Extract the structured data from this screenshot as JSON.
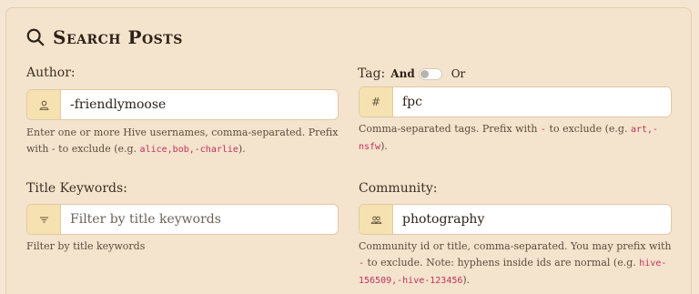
{
  "title": "Search Posts",
  "author": {
    "label": "Author:",
    "value": "-friendlymoose",
    "placeholder": "",
    "help_prefix": "Enter one or more Hive usernames, comma-separated. Prefix with - to exclude (e.g. ",
    "help_code": "alice,bob,-charlie",
    "help_suffix": ")."
  },
  "tag": {
    "label": "Tag:",
    "and_label": "And",
    "or_label": "Or",
    "addon": "#",
    "value": "fpc",
    "help_prefix": "Comma-separated tags. Prefix with ",
    "help_minus": "-",
    "help_middle": " to exclude (e.g. ",
    "help_code": "art,-nsfw",
    "help_suffix": ")."
  },
  "title_keywords": {
    "label": "Title Keywords:",
    "value": "",
    "placeholder": "Filter by title keywords",
    "help": "Filter by title keywords"
  },
  "community": {
    "label": "Community:",
    "value": "photography",
    "help_prefix": "Community id or title, comma-separated. You may prefix with ",
    "help_minus": "-",
    "help_middle": " to exclude. Note: hyphens inside ids are normal (e.g. ",
    "help_code": "hive-156509,-hive-123456",
    "help_suffix": ")."
  },
  "icons": {
    "title": "search-icon",
    "author": "user-icon",
    "tag": "hash-icon",
    "title_keywords": "filter-icon",
    "community": "users-icon"
  },
  "colors": {
    "background": "#f5e6d3",
    "addon": "#f5e2b0",
    "code": "#c0325a"
  }
}
